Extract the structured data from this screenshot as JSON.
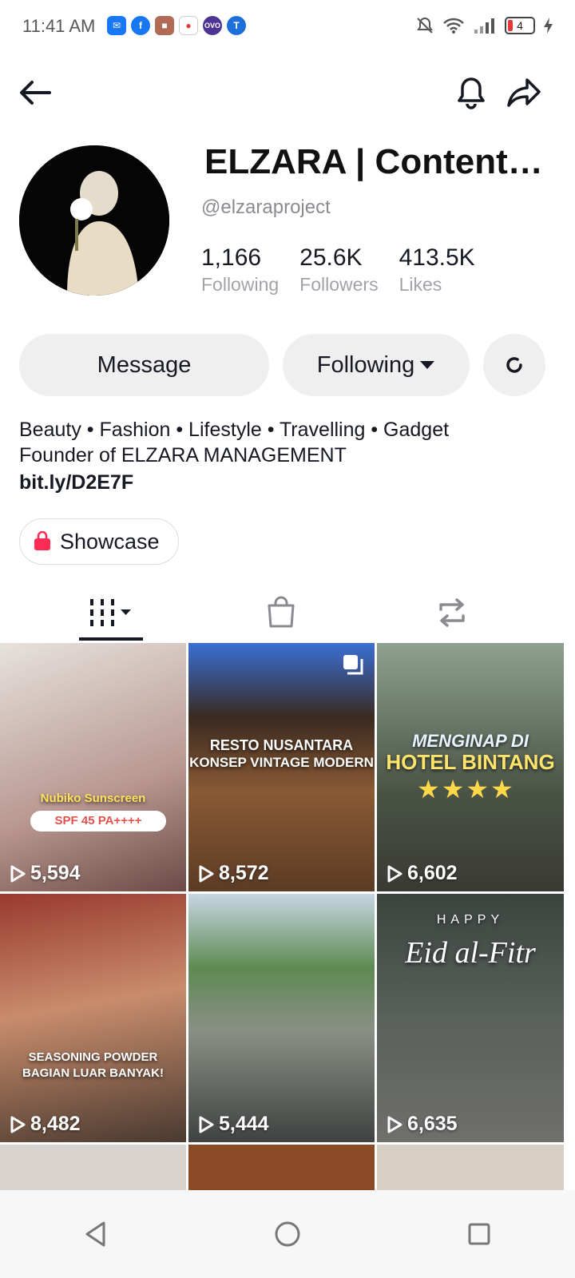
{
  "status_bar": {
    "time": "11:41 AM",
    "battery_level": "4",
    "app_icons": [
      "messenger-icon",
      "facebook-icon",
      "app-icon",
      "app-icon-2",
      "ovo-icon",
      "app-icon-3"
    ]
  },
  "profile": {
    "display_name": "ELZARA | Content…",
    "handle": "@elzaraproject",
    "stats": [
      {
        "value": "1,166",
        "label": "Following"
      },
      {
        "value": "25.6K",
        "label": "Followers"
      },
      {
        "value": "413.5K",
        "label": "Likes"
      }
    ],
    "actions": {
      "message": "Message",
      "following": "Following"
    },
    "bio": {
      "line1": "Beauty • Fashion • Lifestyle • Travelling • Gadget",
      "line2": "Founder of ELZARA MANAGEMENT",
      "link": "bit.ly/D2E7F"
    },
    "showcase_label": "Showcase"
  },
  "tabs": [
    "videos-grid-icon",
    "shop-bag-icon",
    "repost-icon"
  ],
  "videos": [
    {
      "views": "5,594",
      "caption1": "Nubiko Sunscreen",
      "caption2": "SPF 45 PA++++",
      "bg": "#c9b8b4"
    },
    {
      "views": "8,572",
      "caption1": "RESTO NUSANTARA",
      "caption2": "KONSEP VINTAGE MODERN",
      "bg": "#6b4a32"
    },
    {
      "views": "6,602",
      "caption1": "MENGINAP DI",
      "caption2": "HOTEL BINTANG",
      "bg": "#5e6a5a"
    },
    {
      "views": "8,482",
      "caption1": "SEASONING POWDER",
      "caption2": "BAGIAN LUAR BANYAK!",
      "bg": "#7a4b3c"
    },
    {
      "views": "5,444",
      "caption1": "",
      "caption2": "",
      "bg": "#6f8a6a"
    },
    {
      "views": "6,635",
      "caption1": "HAPPY",
      "caption2": "Eid al-Fitr",
      "bg": "#4a4f4c"
    }
  ],
  "colors": {
    "accent": "#fe2c55",
    "text": "#161823",
    "muted": "#a2a3a8"
  }
}
